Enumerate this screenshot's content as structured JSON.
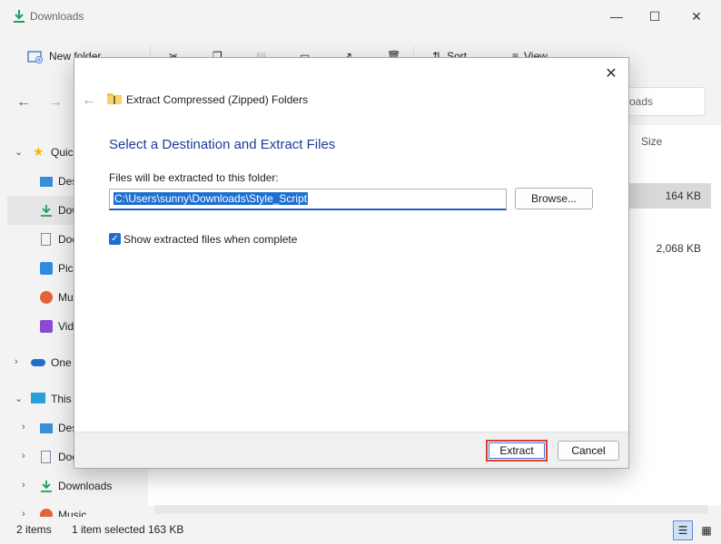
{
  "window": {
    "title": "Downloads"
  },
  "toolbar": {
    "new_folder": "New folder",
    "sort": "Sort",
    "view": "View",
    "more": "..."
  },
  "search": {
    "placeholder_partial": "oads"
  },
  "sidebar": {
    "items": [
      {
        "label": "Quic",
        "icon": "star-icon"
      },
      {
        "label": "Des",
        "icon": "desktop-icon"
      },
      {
        "label": "Dow",
        "icon": "download-icon"
      },
      {
        "label": "Doc",
        "icon": "document-icon"
      },
      {
        "label": "Pic",
        "icon": "pictures-icon"
      },
      {
        "label": "Mu",
        "icon": "music-icon"
      },
      {
        "label": "Vid",
        "icon": "videos-icon"
      },
      {
        "label": "One",
        "icon": "onedrive-icon"
      },
      {
        "label": "This",
        "icon": "pc-icon"
      },
      {
        "label": "Des",
        "icon": "desktop-icon"
      },
      {
        "label": "Doc",
        "icon": "document-icon"
      },
      {
        "label": "Downloads",
        "icon": "download-icon"
      },
      {
        "label": "Music",
        "icon": "music-icon"
      }
    ]
  },
  "content": {
    "size_header": "Size",
    "rows": [
      {
        "size": "164 KB"
      },
      {
        "size": "2,068 KB"
      }
    ]
  },
  "status": {
    "items": "2 items",
    "selected": "1 item selected",
    "size": "163 KB"
  },
  "dialog": {
    "title": "Extract Compressed (Zipped) Folders",
    "heading": "Select a Destination and Extract Files",
    "label": "Files will be extracted to this folder:",
    "path": "C:\\Users\\sunny\\Downloads\\Style_Script",
    "browse": "Browse...",
    "checkbox_label": "Show extracted files when complete",
    "checkbox_checked": true,
    "extract": "Extract",
    "cancel": "Cancel"
  },
  "colors": {
    "accent": "#1f6fd1",
    "heading": "#1e3c96",
    "highlight_box": "#e03a2e"
  }
}
